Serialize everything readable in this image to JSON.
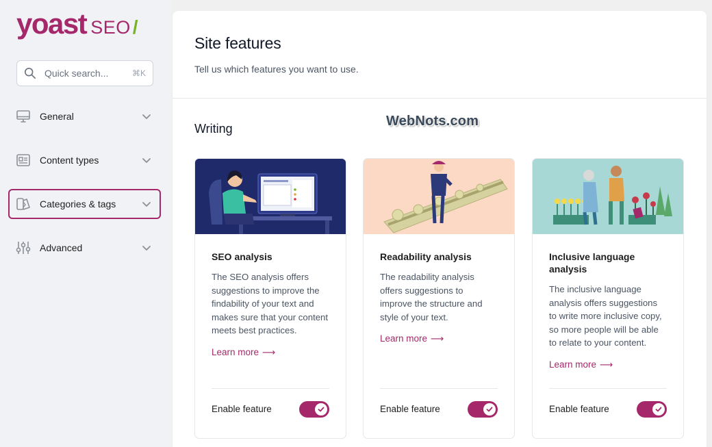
{
  "brand": {
    "name": "yoast",
    "suffix": "SEO",
    "slash": "/"
  },
  "search": {
    "placeholder": "Quick search...",
    "shortcut": "⌘K"
  },
  "sidebar": {
    "items": [
      {
        "label": "General",
        "icon": "monitor-icon"
      },
      {
        "label": "Content types",
        "icon": "content-types-icon"
      },
      {
        "label": "Categories & tags",
        "icon": "tag-icon",
        "active": true
      },
      {
        "label": "Advanced",
        "icon": "sliders-icon"
      }
    ]
  },
  "page": {
    "title": "Site features",
    "subtitle": "Tell us which features you want to use.",
    "section": "Writing",
    "watermark": "WebNots.com"
  },
  "features": [
    {
      "title": "SEO analysis",
      "description": "The SEO analysis offers suggestions to improve the findability of your text and makes sure that your content meets best practices.",
      "learn_more": "Learn more",
      "arrow": "⟶",
      "enable_label": "Enable feature",
      "enabled": true
    },
    {
      "title": "Readability analysis",
      "description": "The readability analysis offers suggestions to improve the structure and style of your text.",
      "learn_more": "Learn more",
      "arrow": "⟶",
      "enable_label": "Enable feature",
      "enabled": true
    },
    {
      "title": "Inclusive language analysis",
      "description": "The inclusive language analysis offers suggestions to write more inclusive copy, so more people will be able to relate to your content.",
      "learn_more": "Learn more",
      "arrow": "⟶",
      "enable_label": "Enable feature",
      "enabled": true
    }
  ],
  "colors": {
    "brand": "#a4286a",
    "brand_green": "#77b227",
    "illus_seo_bg": "#1f2a6b",
    "illus_readability_bg": "#fcd9c4",
    "illus_inclusive_bg": "#a8d8d6"
  }
}
